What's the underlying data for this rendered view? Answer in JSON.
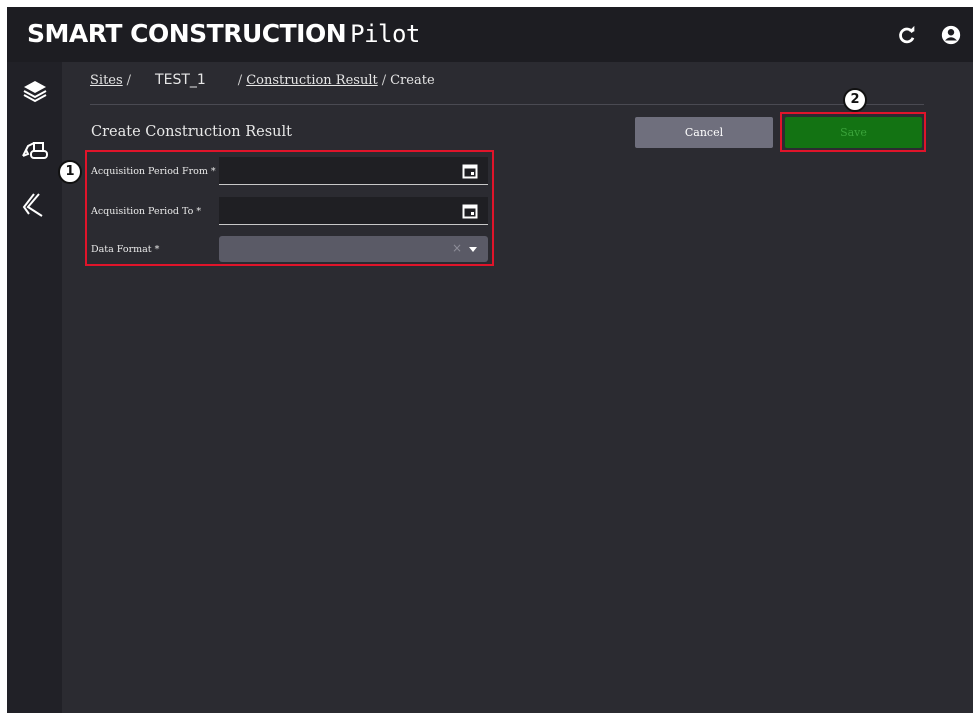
{
  "app": {
    "title": "SMART CONSTRUCTION",
    "subtitle": "Pilot",
    "header_icons": [
      "refresh-icon",
      "user-account-icon"
    ]
  },
  "sidebar": {
    "items": [
      {
        "icon": "layers-icon"
      },
      {
        "icon": "excavator-icon"
      },
      {
        "icon": "slope-icon"
      }
    ]
  },
  "breadcrumb": {
    "sites": "Sites",
    "sep1": "/",
    "site_name": "TEST_1",
    "sep2": "/",
    "construction_result": "Construction Result",
    "sep3": "/",
    "current": "Create"
  },
  "page": {
    "title": "Create Construction Result",
    "cancel_label": "Cancel",
    "save_label": "Save"
  },
  "form": {
    "acquisition_from": {
      "label": "Acquisition Period From *",
      "value": ""
    },
    "acquisition_to": {
      "label": "Acquisition Period To *",
      "value": ""
    },
    "data_format": {
      "label": "Data Format *",
      "value": "",
      "clear": "×"
    }
  },
  "annotations": {
    "callout_1": "1",
    "callout_2": "2",
    "highlight_color": "#e0142a"
  },
  "colors": {
    "header_bg": "#1d1d22",
    "content_bg": "#2b2b31",
    "save_green": "#137313",
    "cancel_gray": "#6f6f7d"
  }
}
